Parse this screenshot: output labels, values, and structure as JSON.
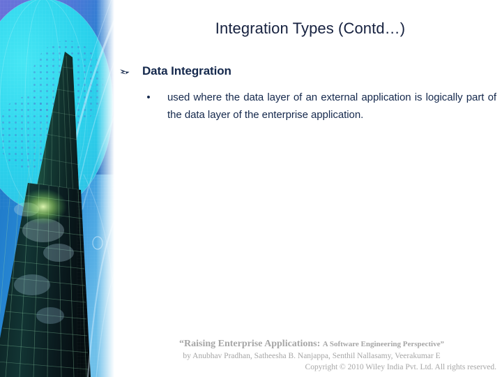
{
  "slide": {
    "title": "Integration Types (Contd…)",
    "background_color": "#ffffff",
    "text_color": "#14284c",
    "title_color": "#16213f"
  },
  "content": {
    "level1_bullet_glyph": "wingdings-arrow-bullet",
    "level1_heading": "Data Integration",
    "level2_bullet_glyph": "•",
    "level2_text": "used where the data layer of an external application is logically part of the data layer of the enterprise application."
  },
  "image_panel": {
    "name": "skyscraper-globe-graphic",
    "colors": {
      "purple_blue": "#5f6fd6",
      "cyan": "#2ad5ee",
      "deep_blue": "#1f6fc4",
      "green_glass": "#2e7a5c",
      "dark_glass": "#0d1a1c"
    }
  },
  "footer": {
    "line1_main": "“Raising Enterprise Applications:",
    "line1_small": "A Software Engineering Perspective”",
    "line2": "by Anubhav Pradhan, Satheesha B. Nanjappa, Senthil Nallasamy, Veerakumar E",
    "line3": "Copyright © 2010 Wiley India Pvt. Ltd.  All rights reserved.",
    "color": "#a6a6a6"
  }
}
